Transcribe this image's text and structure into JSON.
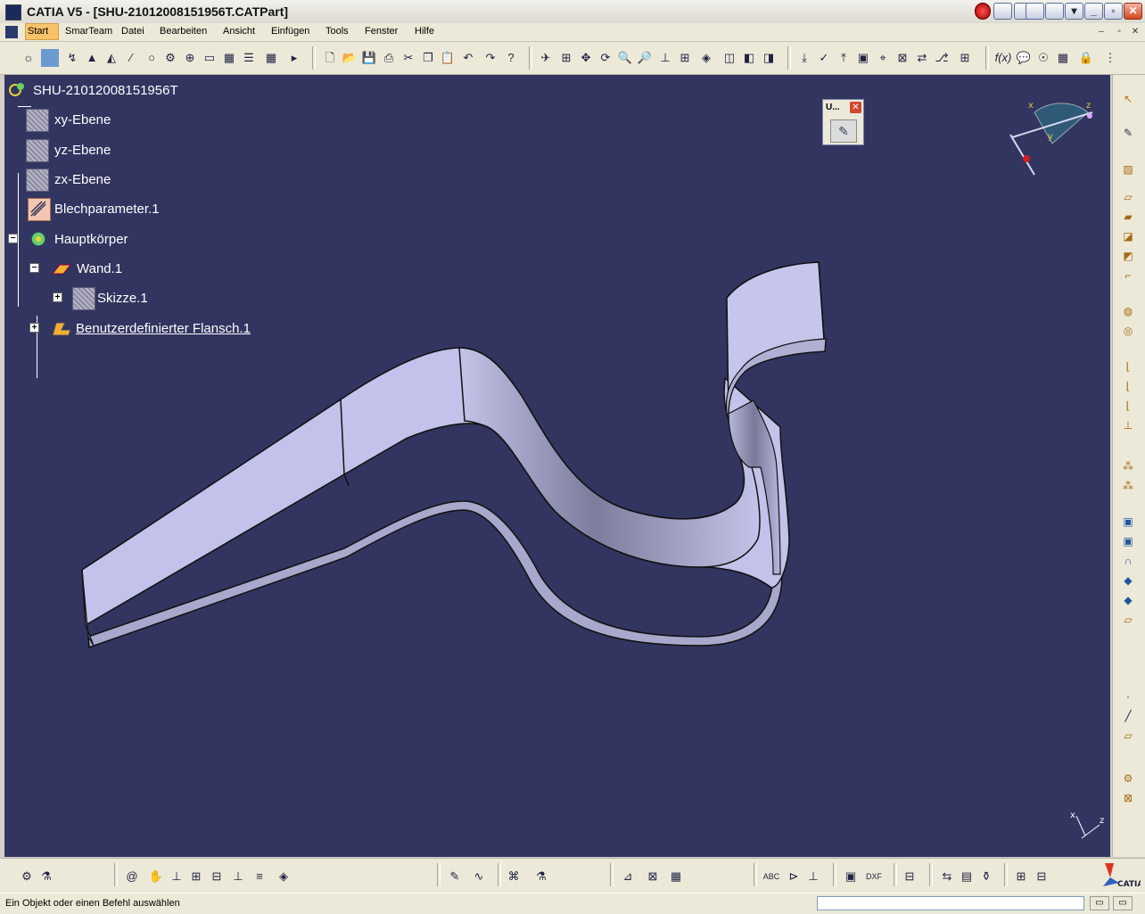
{
  "window": {
    "title": "CATIA V5 - [SHU-21012008151956T.CATPart]",
    "app_icon": "catia-icon"
  },
  "menubar": {
    "items": [
      {
        "label": "Start"
      },
      {
        "label": "SmarTeam"
      },
      {
        "label": "Datei"
      },
      {
        "label": "Bearbeiten"
      },
      {
        "label": "Ansicht"
      },
      {
        "label": "Einfügen"
      },
      {
        "label": "Tools"
      },
      {
        "label": "Fenster"
      },
      {
        "label": "Hilfe"
      }
    ]
  },
  "tree": {
    "root": "SHU-21012008151956T",
    "nodes": [
      {
        "label": "xy-Ebene",
        "icon": "plane-icon"
      },
      {
        "label": "yz-Ebene",
        "icon": "plane-icon"
      },
      {
        "label": "zx-Ebene",
        "icon": "plane-icon"
      },
      {
        "label": "Blechparameter.1",
        "icon": "sheetmetal-parameters-icon"
      },
      {
        "label": "Hauptkörper",
        "icon": "body-icon"
      },
      {
        "label": "Wand.1",
        "icon": "wall-icon"
      },
      {
        "label": "Skizze.1",
        "icon": "sketch-icon"
      },
      {
        "label": "Benutzerdefinierter Flansch.1",
        "icon": "user-flange-icon"
      }
    ]
  },
  "mini_toolbar": {
    "title": "U...",
    "button_icon": "user-selection-filter-icon"
  },
  "compass": {
    "x_label": "x",
    "y_label": "y",
    "z_label": "z"
  },
  "axis_triad": {
    "x_label": "x",
    "z_label": "z"
  },
  "status": {
    "message": "Ein Objekt oder einen Befehl auswählen"
  },
  "colors": {
    "viewport_bg": "#32355f",
    "part_face": "#c0c0e8",
    "menu_highlight": "#f7c26a"
  }
}
